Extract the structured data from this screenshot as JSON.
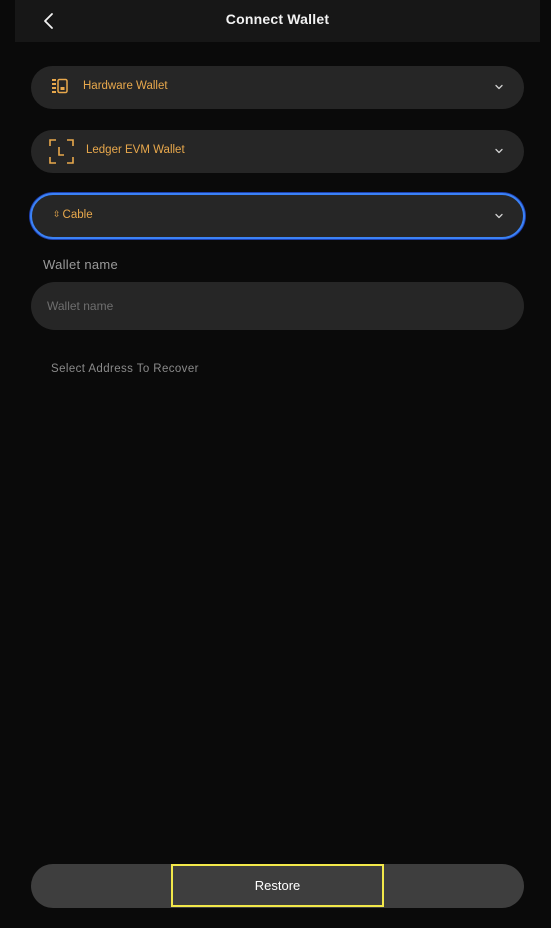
{
  "header": {
    "title": "Connect Wallet",
    "back_icon": "chevron-left-icon"
  },
  "dropdowns": [
    {
      "label": "Hardware Wallet",
      "icon": "hardware-wallet-icon"
    },
    {
      "label": "Ledger EVM Wallet",
      "icon": "scan-frame-icon"
    },
    {
      "label": "Cable",
      "icon": "swap-vertical-icon"
    }
  ],
  "wallet_name": {
    "label": "Wallet name",
    "placeholder": "Wallet name",
    "value": ""
  },
  "select_address_text": "Select Address To Recover",
  "restore": {
    "label": "Restore"
  },
  "colors": {
    "background": "#0a0a0a",
    "header": "#171717",
    "field": "#262626",
    "accent": "#e8a84c",
    "focus_border": "#3b82f6",
    "highlight": "#f2e84a"
  }
}
